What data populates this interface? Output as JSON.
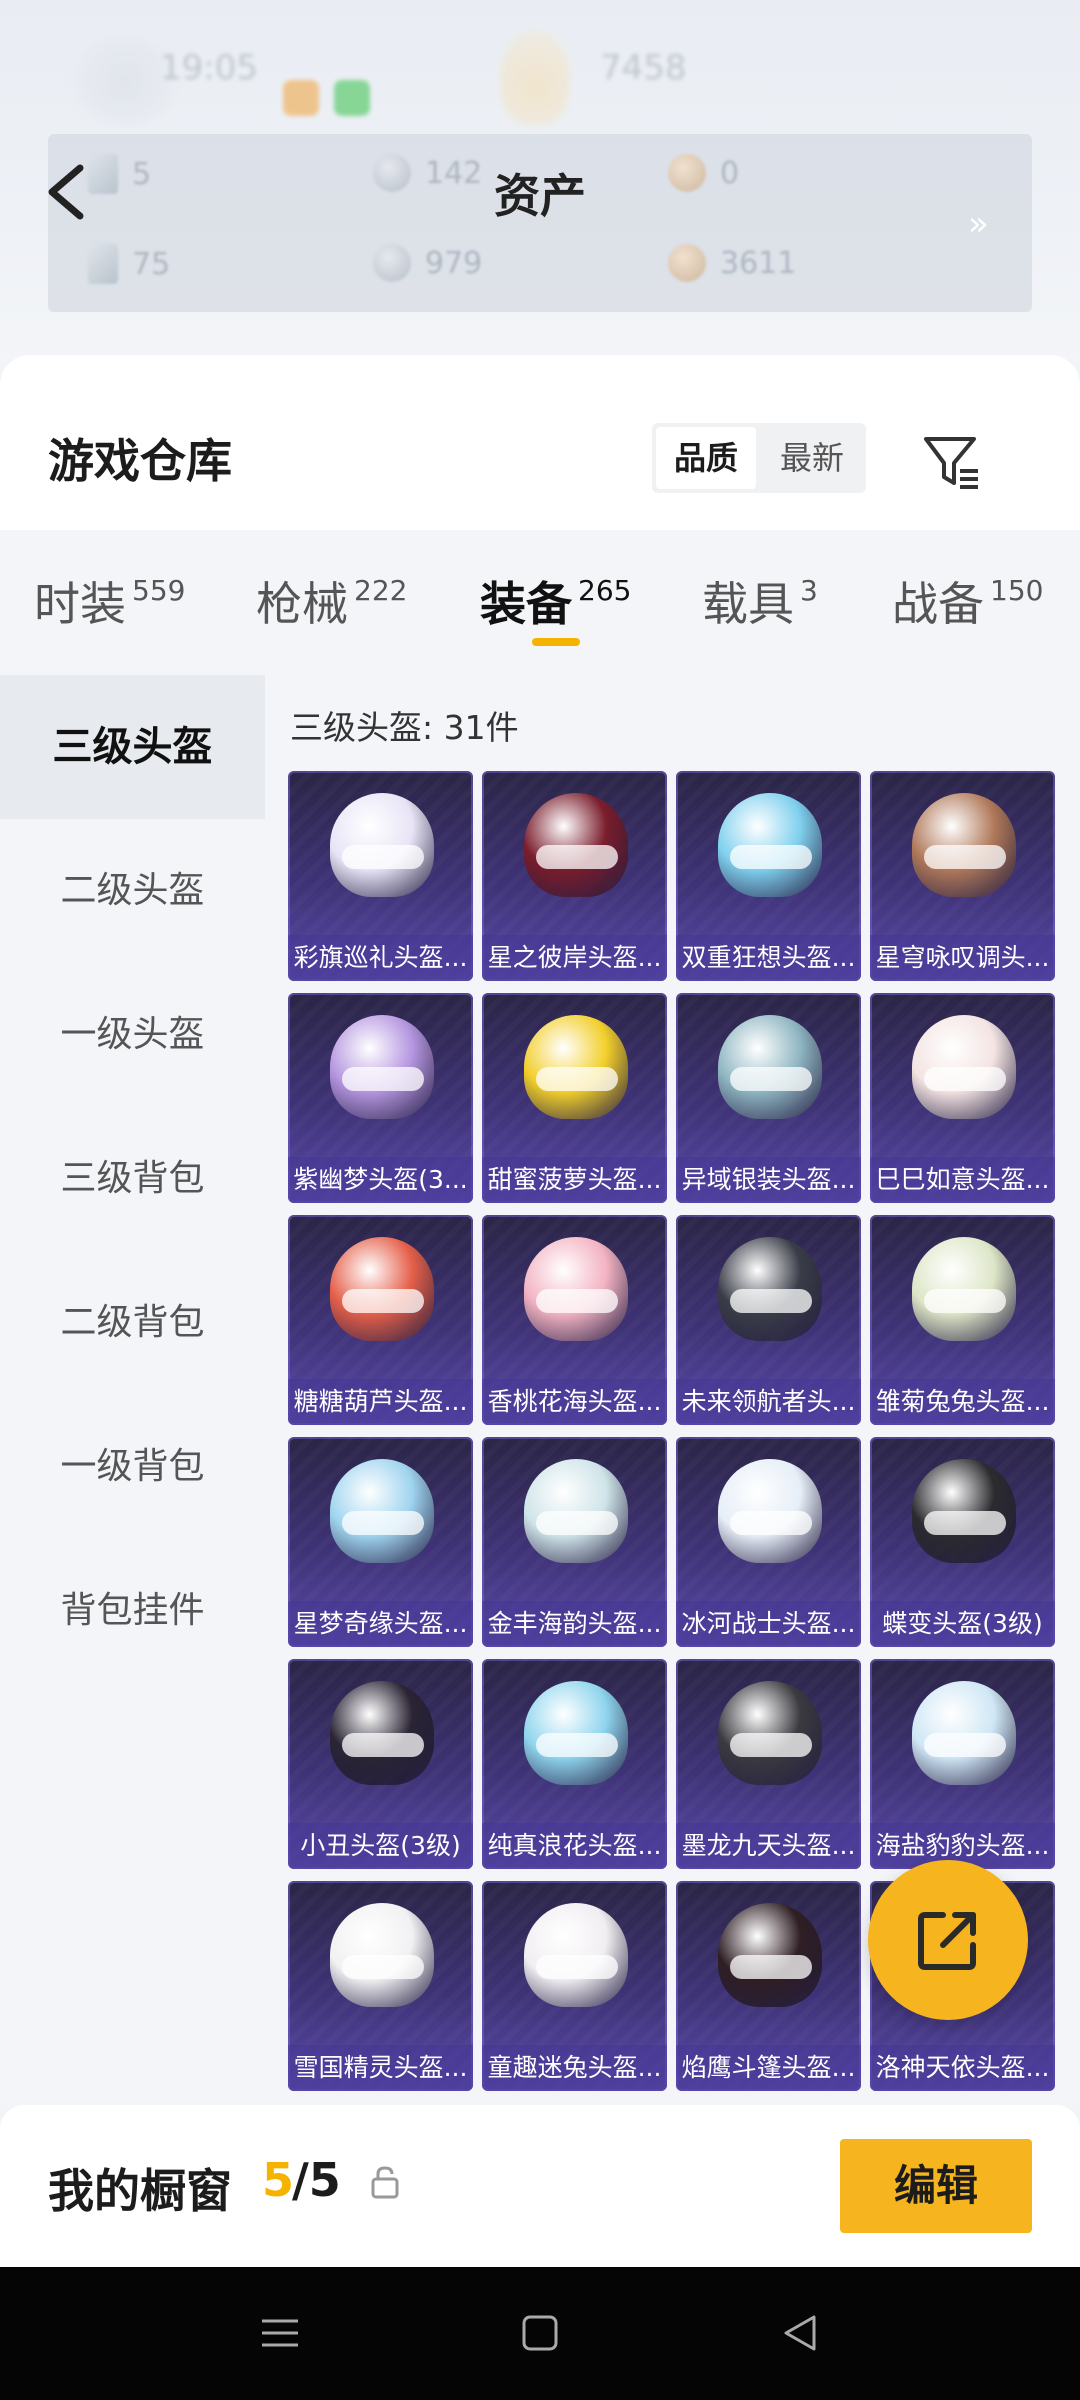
{
  "status_bar": {
    "time": "19:05",
    "right_text": "7458"
  },
  "header": {
    "title": "资产",
    "assets": [
      {
        "icon": "card-icon",
        "value": "5"
      },
      {
        "icon": "silver-coin-icon",
        "value": "142"
      },
      {
        "icon": "bronze-coin-icon",
        "value": "0"
      },
      {
        "icon": "card-icon",
        "value": "75"
      },
      {
        "icon": "silver-coin-icon",
        "value": "979"
      },
      {
        "icon": "bronze-coin-icon",
        "value": "3611"
      }
    ],
    "more_label": "»"
  },
  "warehouse": {
    "title": "游戏仓库",
    "sort_options": [
      "品质",
      "最新"
    ],
    "sort_selected": "品质"
  },
  "tabs": [
    {
      "label": "时装",
      "count": "559"
    },
    {
      "label": "枪械",
      "count": "222"
    },
    {
      "label": "装备",
      "count": "265"
    },
    {
      "label": "载具",
      "count": "3"
    },
    {
      "label": "战备",
      "count": "150"
    }
  ],
  "active_tab": "装备",
  "sidebar": {
    "items": [
      "三级头盔",
      "二级头盔",
      "一级头盔",
      "三级背包",
      "二级背包",
      "一级背包",
      "背包挂件"
    ],
    "active": "三级头盔"
  },
  "section_title": "三级头盔: 31件",
  "items": [
    {
      "name": "彩旗巡礼头盔...",
      "color": "#e8e4f6"
    },
    {
      "name": "星之彼岸头盔...",
      "color": "#7a1d2c"
    },
    {
      "name": "双重狂想头盔...",
      "color": "#7fd0ee"
    },
    {
      "name": "星穹咏叹调头...",
      "color": "#b0795a"
    },
    {
      "name": "紫幽梦头盔(3...",
      "color": "#b596e0"
    },
    {
      "name": "甜蜜菠萝头盔...",
      "color": "#f2cf2c"
    },
    {
      "name": "异域银装头盔...",
      "color": "#8fb6c2"
    },
    {
      "name": "巳巳如意头盔...",
      "color": "#f3e4e2"
    },
    {
      "name": "糖糖葫芦头盔...",
      "color": "#e5604a"
    },
    {
      "name": "香桃花海头盔...",
      "color": "#f3b3c3"
    },
    {
      "name": "未来领航者头...",
      "color": "#3a3d48"
    },
    {
      "name": "雏菊兔兔头盔...",
      "color": "#dde6c7"
    },
    {
      "name": "星梦奇缘头盔...",
      "color": "#9fd4ef"
    },
    {
      "name": "金丰海韵头盔...",
      "color": "#cfe4e9"
    },
    {
      "name": "冰河战士头盔...",
      "color": "#e6eef7"
    },
    {
      "name": "蝶变头盔(3级)",
      "color": "#2b2b2f"
    },
    {
      "name": "小丑头盔(3级)",
      "color": "#2a2434"
    },
    {
      "name": "纯真浪花头盔...",
      "color": "#8fd5ee"
    },
    {
      "name": "墨龙九天头盔...",
      "color": "#3b3a40"
    },
    {
      "name": "海盐豹豹头盔...",
      "color": "#cfe7f5"
    },
    {
      "name": "雪国精灵头盔...",
      "color": "#f1f1f3"
    },
    {
      "name": "童趣迷兔头盔...",
      "color": "#f1eef2"
    },
    {
      "name": "焰鹰斗篷头盔...",
      "color": "#2f1f24"
    },
    {
      "name": "洛神天依头盔...",
      "color": "#eaf1f7"
    }
  ],
  "showcase": {
    "label": "我的橱窗",
    "current": "5",
    "total": "/5"
  },
  "edit_label": "编辑"
}
